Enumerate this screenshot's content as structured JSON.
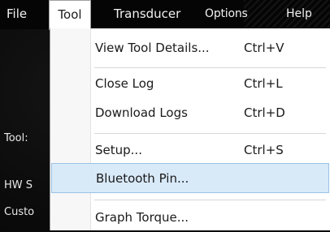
{
  "menubar": {
    "items": [
      {
        "label": "File"
      },
      {
        "label": "Tool"
      },
      {
        "label": "Transducer"
      },
      {
        "label": "Options"
      },
      {
        "label": "Help"
      }
    ]
  },
  "background": {
    "labels": [
      "Tool:",
      "HW S",
      "Custo"
    ]
  },
  "dropdown": {
    "items": [
      {
        "label": "View Tool Details...",
        "shortcut": "Ctrl+V"
      },
      {
        "label": "Close Log",
        "shortcut": "Ctrl+L"
      },
      {
        "label": "Download Logs",
        "shortcut": "Ctrl+D"
      },
      {
        "label": "Setup...",
        "shortcut": "Ctrl+S"
      },
      {
        "label": "Bluetooth Pin...",
        "shortcut": ""
      },
      {
        "label": "Graph Torque...",
        "shortcut": ""
      }
    ],
    "highlighted_index": 4
  },
  "colors": {
    "app_background": "#080808",
    "menu_text": "#f2f2f2",
    "highlight_fill": "#d8e9f8",
    "highlight_border": "#9cc3e6"
  }
}
